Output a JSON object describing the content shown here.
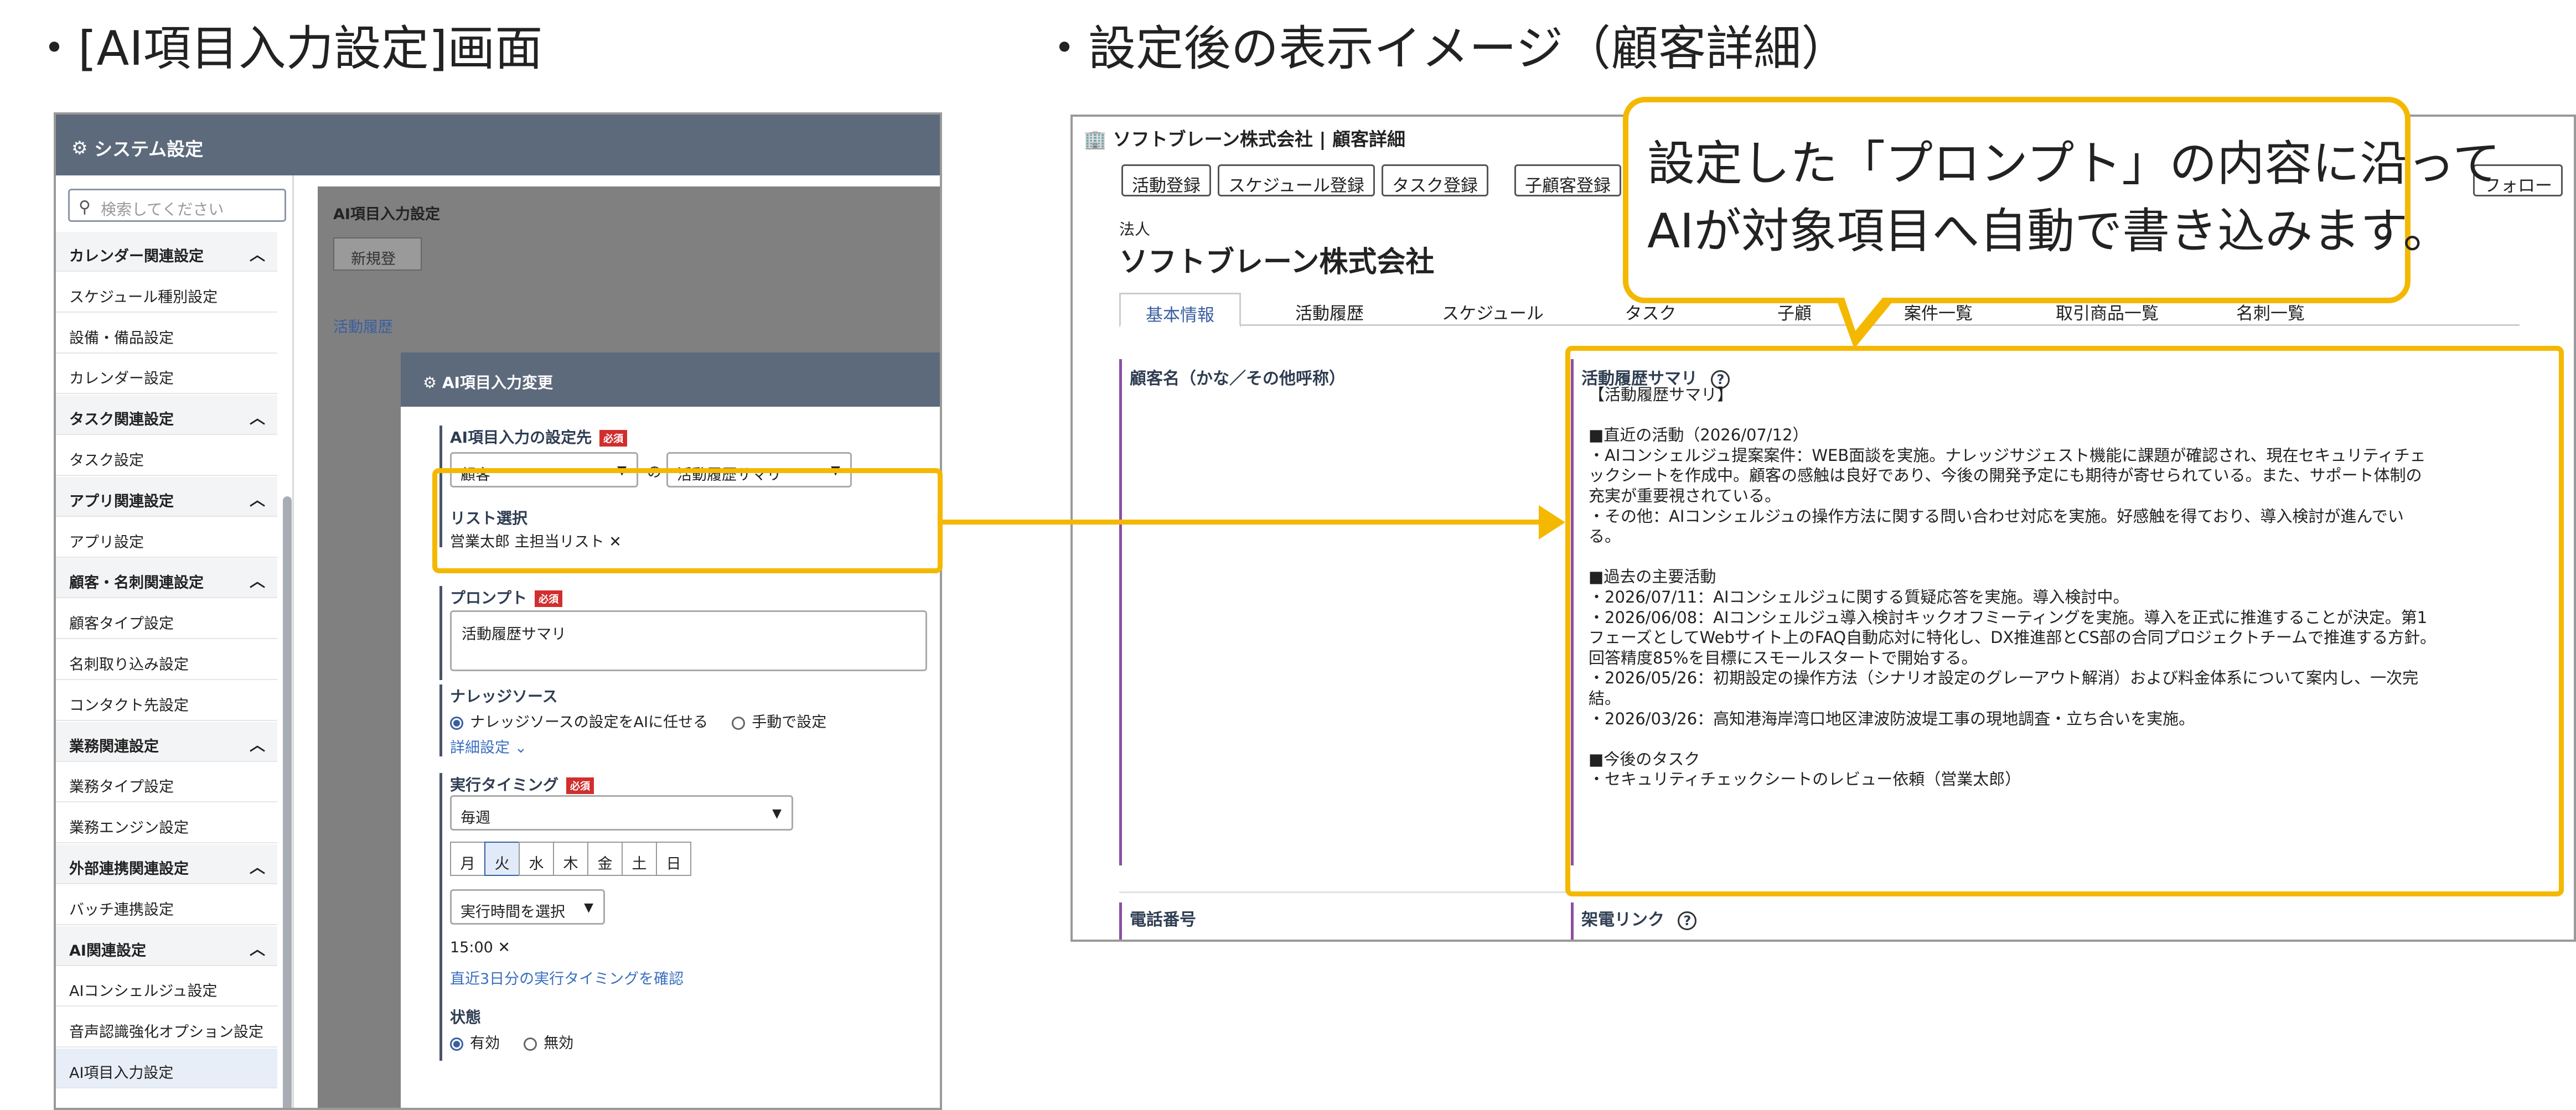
{
  "headings": {
    "left": "・[AI項目入力設定]画面",
    "right": "・設定後の表示イメージ（顧客詳細）"
  },
  "left_screen": {
    "topbar_title": "システム設定",
    "search_placeholder": "検索してください",
    "sidebar": [
      {
        "label": "カレンダー関連設定",
        "category": true
      },
      {
        "label": "スケジュール種別設定",
        "category": false
      },
      {
        "label": "設備・備品設定",
        "category": false
      },
      {
        "label": "カレンダー設定",
        "category": false
      },
      {
        "label": "タスク関連設定",
        "category": true
      },
      {
        "label": "タスク設定",
        "category": false
      },
      {
        "label": "アプリ関連設定",
        "category": true
      },
      {
        "label": "アプリ設定",
        "category": false
      },
      {
        "label": "顧客・名刺関連設定",
        "category": true
      },
      {
        "label": "顧客タイプ設定",
        "category": false
      },
      {
        "label": "名刺取り込み設定",
        "category": false
      },
      {
        "label": "コンタクト先設定",
        "category": false
      },
      {
        "label": "業務関連設定",
        "category": true
      },
      {
        "label": "業務タイプ設定",
        "category": false
      },
      {
        "label": "業務エンジン設定",
        "category": false
      },
      {
        "label": "外部連携関連設定",
        "category": true
      },
      {
        "label": "バッチ連携設定",
        "category": false
      },
      {
        "label": "AI関連設定",
        "category": true
      },
      {
        "label": "AIコンシェルジュ設定",
        "category": false
      },
      {
        "label": "音声認識強化オプション設定",
        "category": false
      },
      {
        "label": "AI項目入力設定",
        "category": false,
        "active": true
      }
    ],
    "back_panel": {
      "title": "AI項目入力設定",
      "new_button": "新規登",
      "row_text": "活動履歴"
    },
    "modal": {
      "title": "AI項目入力変更",
      "required_badge": "必須",
      "target_label": "AI項目入力の設定先",
      "target_object": "顧客",
      "connector": "の",
      "target_field": "活動履歴サマリ",
      "list_label": "リスト選択",
      "list_value": "営業太郎 主担当リスト",
      "prompt_label": "プロンプト",
      "prompt_value": "活動履歴サマリ",
      "knowledge_label": "ナレッジソース",
      "knowledge_opt_ai": "ナレッジソースの設定をAIに任せる",
      "knowledge_opt_manual": "手動で設定",
      "detail_link": "詳細設定",
      "timing_label": "実行タイミング",
      "timing_value": "毎週",
      "days": [
        "月",
        "火",
        "水",
        "木",
        "金",
        "土",
        "日"
      ],
      "selected_day": "火",
      "time_select": "実行時間を選択",
      "time_value": "15:00",
      "timing_link": "直近3日分の実行タイミングを確認",
      "status_label": "状態",
      "status_on": "有効",
      "status_off": "無効"
    }
  },
  "right_screen": {
    "title": "ソフトブレーン株式会社 | 顧客詳細",
    "buttons": [
      "活動登録",
      "スケジュール登録",
      "タスク登録",
      "子顧客登録"
    ],
    "follow_button": "フォロー",
    "company_type": "法人",
    "company_name": "ソフトブレーン株式会社",
    "tabs": [
      "基本情報",
      "活動履歴",
      "スケジュール",
      "タスク",
      "子顧",
      "案件一覧",
      "取引商品一覧",
      "名刺一覧"
    ],
    "field_label_name": "顧客名（かな／その他呼称）",
    "field_label_phone": "電話番号",
    "summary_label": "活動履歴サマリ",
    "call_link_label": "架電リンク",
    "summary_lines": [
      "【活動履歴サマリ】",
      "",
      "■直近の活動（2026/07/12）",
      "・AIコンシェルジュ提案案件：WEB面談を実施。ナレッジサジェスト機能に課題が確認され、現在セキュリティチェ",
      "ックシートを作成中。顧客の感触は良好であり、今後の開発予定にも期待が寄せられている。また、サポート体制の",
      "充実が重要視されている。",
      "・その他：AIコンシェルジュの操作方法に関する問い合わせ対応を実施。好感触を得ており、導入検討が進んでい",
      "る。",
      "",
      "■過去の主要活動",
      "・2026/07/11：AIコンシェルジュに関する質疑応答を実施。導入検討中。",
      "・2026/06/08：AIコンシェルジュ導入検討キックオフミーティングを実施。導入を正式に推進することが決定。第1",
      "フェーズとしてWebサイト上のFAQ自動応対に特化し、DX推進部とCS部の合同プロジェクトチームで推進する方針。",
      "回答精度85%を目標にスモールスタートで開始する。",
      "・2026/05/26：初期設定の操作方法（シナリオ設定のグレーアウト解消）および料金体系について案内し、一次完",
      "結。",
      "・2026/03/26：高知港海岸湾口地区津波防波堤工事の現地調査・立ち合いを実施。",
      "",
      "■今後のタスク",
      "・セキュリティチェックシートのレビュー依頼（営業太郎）"
    ]
  },
  "callout": {
    "line1": "設定した「プロンプト」の内容に沿って",
    "line2": "AIが対象項目へ自動で書き込みます。"
  },
  "colors": {
    "highlight": "#f4b800",
    "header_bar": "#5d6a7c",
    "accent_blue": "#3a5fa0",
    "required_red": "#d12e2e"
  }
}
